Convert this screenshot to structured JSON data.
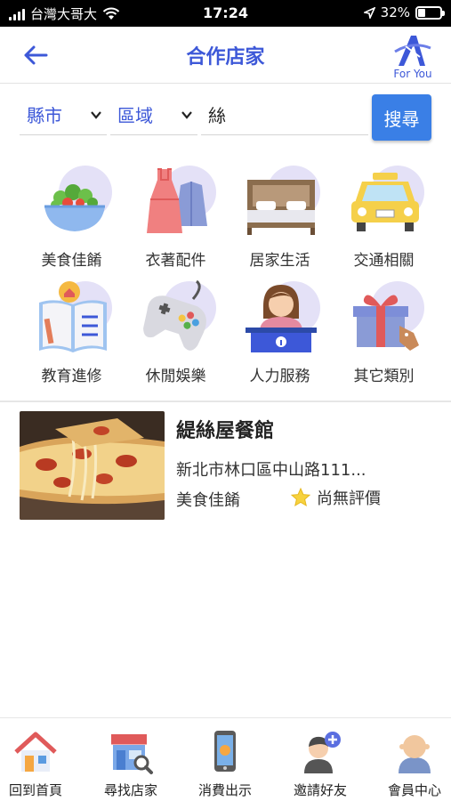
{
  "status_bar": {
    "carrier": "台灣大哥大",
    "time": "17:24",
    "battery": "32%",
    "battery_level": 0.32
  },
  "header": {
    "title": "合作店家",
    "logo_text": "For You"
  },
  "filters": {
    "county_label": "縣市",
    "area_label": "區域",
    "keyword_value": "絲",
    "search_label": "搜尋"
  },
  "categories": [
    {
      "label": "美食佳餚",
      "icon": "salad-bowl-icon"
    },
    {
      "label": "衣著配件",
      "icon": "clothing-icon"
    },
    {
      "label": "居家生活",
      "icon": "bed-icon"
    },
    {
      "label": "交通相關",
      "icon": "taxi-icon"
    },
    {
      "label": "教育進修",
      "icon": "book-icon"
    },
    {
      "label": "休閒娛樂",
      "icon": "gamepad-icon"
    },
    {
      "label": "人力服務",
      "icon": "receptionist-icon"
    },
    {
      "label": "其它類別",
      "icon": "gift-icon"
    }
  ],
  "stores": [
    {
      "name": "緹絲屋餐館",
      "address": "新北市林口區中山路111...",
      "category": "美食佳餚",
      "rating_text": "尚無評價",
      "image": "pizza-photo"
    }
  ],
  "bottom_nav": [
    {
      "label": "回到首頁",
      "icon": "home-icon"
    },
    {
      "label": "尋找店家",
      "icon": "store-search-icon"
    },
    {
      "label": "消費出示",
      "icon": "phone-icon"
    },
    {
      "label": "邀請好友",
      "icon": "invite-friend-icon"
    },
    {
      "label": "會員中心",
      "icon": "member-icon"
    }
  ],
  "colors": {
    "accent": "#3d58d8",
    "button": "#3a7fe6",
    "icon_circle": "#e4e1f7"
  }
}
